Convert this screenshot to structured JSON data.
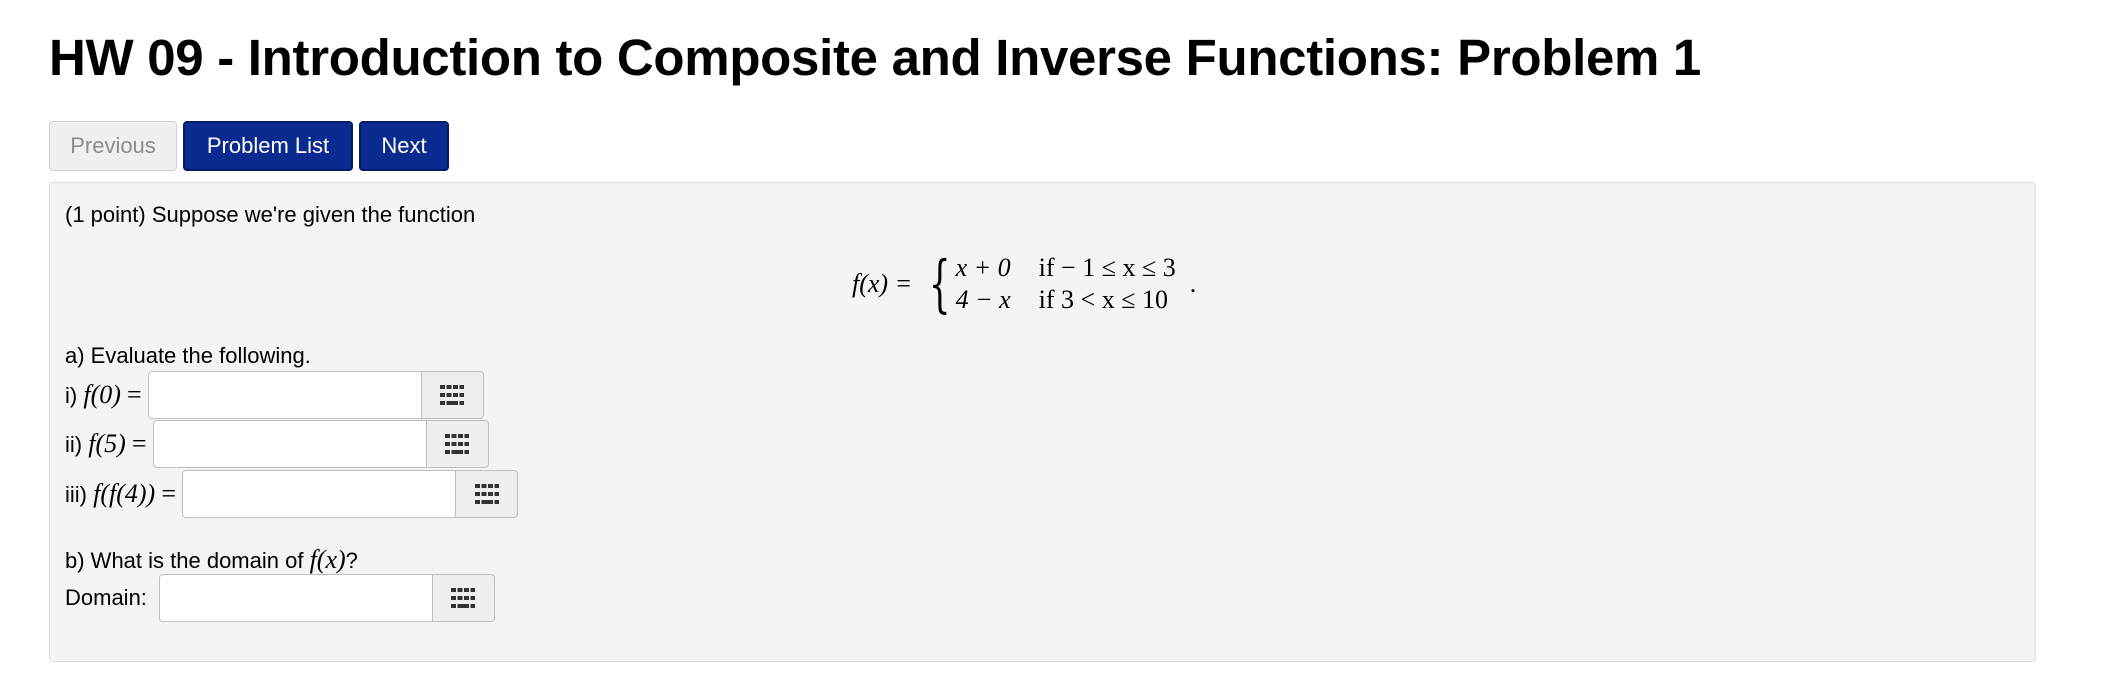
{
  "page": {
    "title": "HW 09 - Introduction to Composite and Inverse Functions: Problem 1"
  },
  "nav": {
    "previous_label": "Previous",
    "problem_list_label": "Problem List",
    "next_label": "Next"
  },
  "problem": {
    "intro": "(1 point) Suppose we're given the function",
    "function": {
      "lhs": "f(x) =",
      "cases": [
        {
          "expr": "x + 0",
          "condition": "if − 1 ≤ x ≤ 3"
        },
        {
          "expr": "4 − x",
          "condition": "if 3 < x ≤ 10"
        }
      ],
      "trailing": "."
    },
    "part_a": {
      "heading": "a) Evaluate the following.",
      "items": [
        {
          "prefix": "i)",
          "expr": "f(0)",
          "equals": "=",
          "value": ""
        },
        {
          "prefix": "ii)",
          "expr": "f(5)",
          "equals": "=",
          "value": ""
        },
        {
          "prefix": "iii)",
          "expr": "f(f(4))",
          "equals": "=",
          "value": ""
        }
      ]
    },
    "part_b": {
      "question_prefix": "b) What is the domain of",
      "question_expr": "f(x)",
      "question_suffix": "?",
      "domain_label": "Domain:",
      "value": ""
    }
  },
  "icons": {
    "equation_editor": "keypad-grid-icon"
  }
}
